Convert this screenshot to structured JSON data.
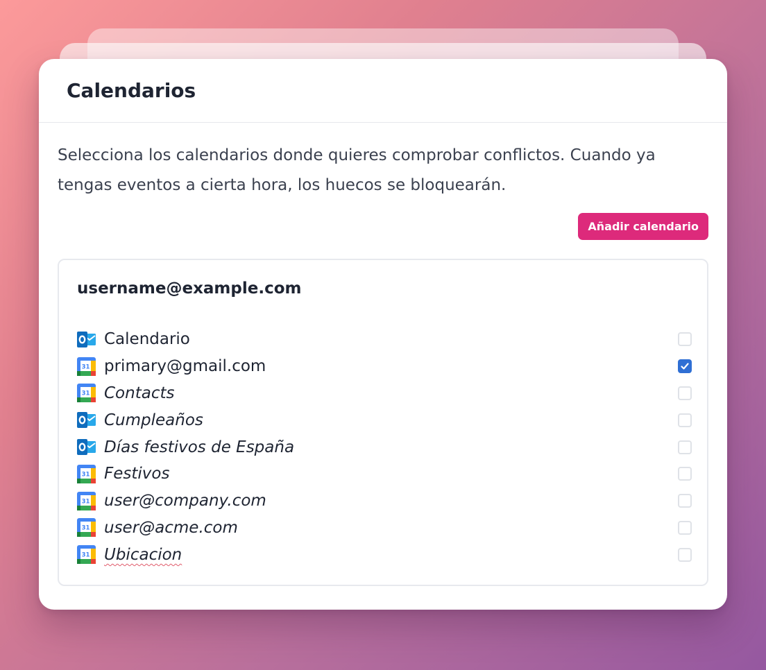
{
  "dialog": {
    "title": "Calendarios",
    "description": "Selecciona los calendarios donde quieres comprobar conflictos. Cuando ya tengas eventos a cierta hora, los huecos se bloquearán.",
    "add_button_label": "Añadir calendario"
  },
  "account": {
    "email": "username@example.com",
    "calendars": [
      {
        "name": "Calendario",
        "provider": "outlook-icon",
        "italic": false,
        "checked": false
      },
      {
        "name": "primary@gmail.com",
        "provider": "google-calendar-icon",
        "italic": false,
        "checked": true
      },
      {
        "name": "Contacts",
        "provider": "google-calendar-icon",
        "italic": true,
        "checked": false
      },
      {
        "name": "Cumpleaños",
        "provider": "outlook-icon",
        "italic": true,
        "checked": false
      },
      {
        "name": "Días festivos de España",
        "provider": "outlook-icon",
        "italic": true,
        "checked": false
      },
      {
        "name": "Festivos",
        "provider": "google-calendar-icon",
        "italic": true,
        "checked": false
      },
      {
        "name": "user@company.com",
        "provider": "google-calendar-icon",
        "italic": true,
        "checked": false
      },
      {
        "name": "user@acme.com",
        "provider": "google-calendar-icon",
        "italic": true,
        "checked": false
      },
      {
        "name": "Ubicacion",
        "provider": "google-calendar-icon",
        "italic": true,
        "checked": false
      }
    ]
  },
  "google_icon_day": "31",
  "colors": {
    "accent_button": "#dd2a7b",
    "checkbox_checked": "#2f6fd4"
  }
}
